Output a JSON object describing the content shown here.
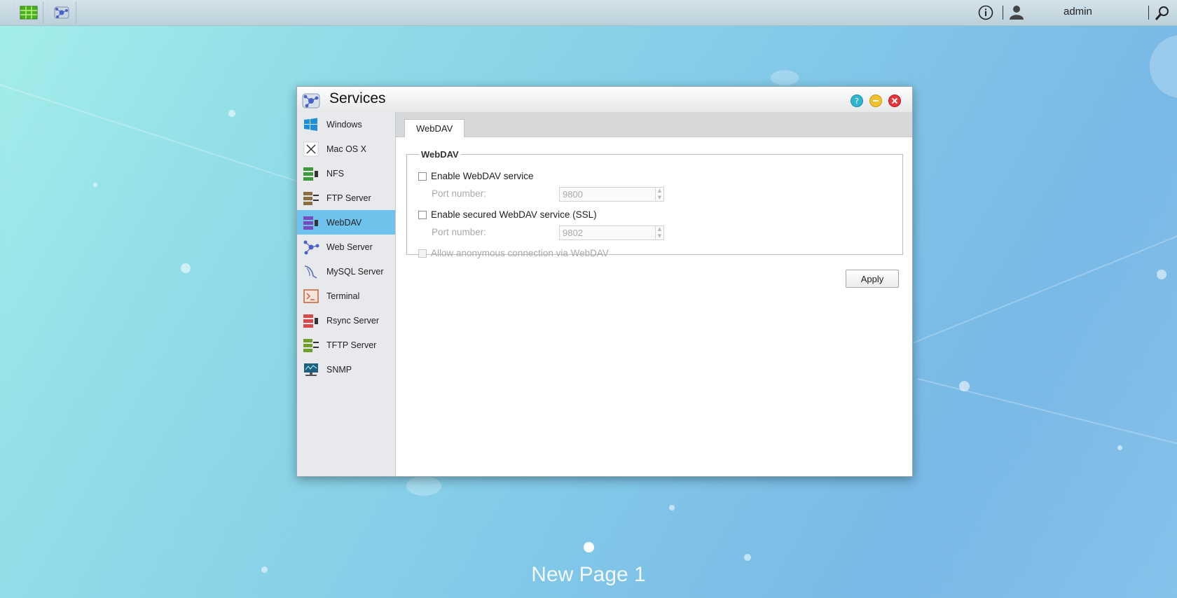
{
  "topbar": {
    "user_label": "admin",
    "left_buttons": [
      "main-menu-icon",
      "services-app-icon"
    ],
    "right_icons": [
      "info-icon",
      "user-icon",
      "search-icon"
    ]
  },
  "window": {
    "title": "Services",
    "title_icon": "services-icon",
    "controls": [
      "help-icon",
      "minimize-icon",
      "close-icon"
    ]
  },
  "sidebar": {
    "active_index": 4,
    "items": [
      {
        "label": "Windows",
        "icon": "windows-icon"
      },
      {
        "label": "Mac OS X",
        "icon": "mac-os-x-icon"
      },
      {
        "label": "NFS",
        "icon": "nfs-icon"
      },
      {
        "label": "FTP Server",
        "icon": "ftp-server-icon"
      },
      {
        "label": "WebDAV",
        "icon": "webdav-icon"
      },
      {
        "label": "Web Server",
        "icon": "web-server-icon"
      },
      {
        "label": "MySQL Server",
        "icon": "mysql-server-icon"
      },
      {
        "label": "Terminal",
        "icon": "terminal-icon"
      },
      {
        "label": "Rsync Server",
        "icon": "rsync-server-icon"
      },
      {
        "label": "TFTP Server",
        "icon": "tftp-server-icon"
      },
      {
        "label": "SNMP",
        "icon": "snmp-icon"
      }
    ]
  },
  "tabs": [
    {
      "label": "WebDAV"
    }
  ],
  "webdav": {
    "legend": "WebDAV",
    "enable_label": "Enable WebDAV service",
    "enable_checked": false,
    "port_label": "Port number:",
    "port_value": "9800",
    "ssl_label": "Enable secured WebDAV service (SSL)",
    "ssl_checked": false,
    "ssl_port_label": "Port number:",
    "ssl_port_value": "9802",
    "anon_label": "Allow anonymous connection via WebDAV",
    "anon_checked": false,
    "apply_label": "Apply"
  },
  "desktop": {
    "page_label": "New Page 1"
  },
  "colors": {
    "active_item": "#6ec2ec",
    "close_button": "#e8343b",
    "minimize_button": "#f2c12e",
    "help_button": "#2fb5d0"
  }
}
